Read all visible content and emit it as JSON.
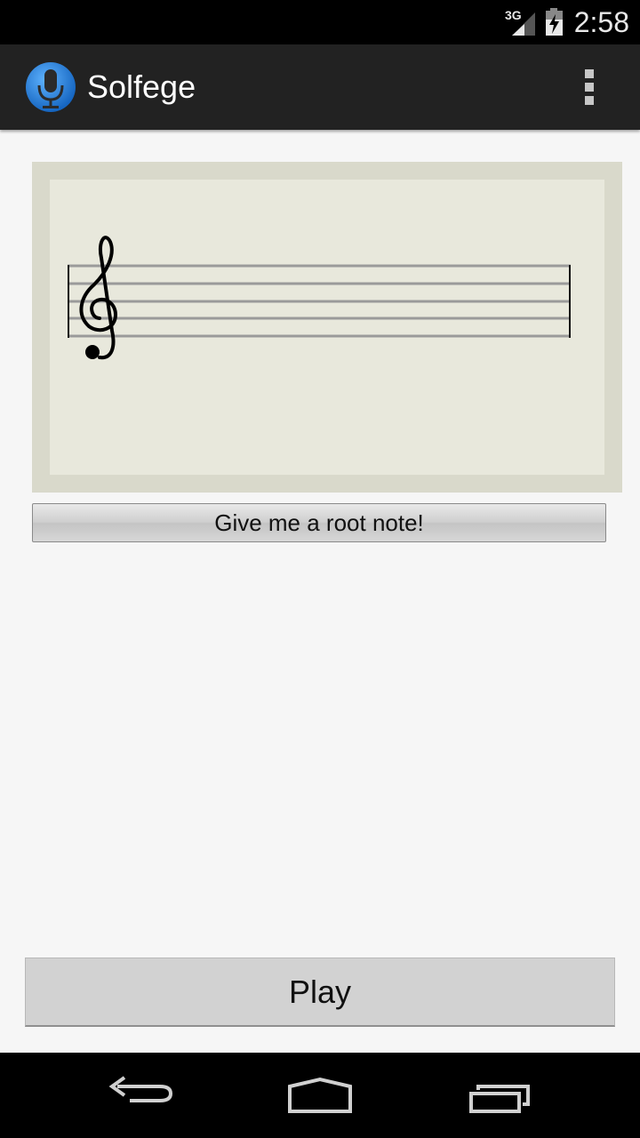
{
  "status_bar": {
    "network_label": "3G",
    "time": "2:58",
    "icons": [
      "signal-icon",
      "battery-icon"
    ]
  },
  "action_bar": {
    "title": "Solfege",
    "icons": [
      "microphone-icon",
      "overflow-menu-icon"
    ]
  },
  "staff": {
    "clef": "treble-clef-icon",
    "note_count": 0
  },
  "root_note_button": {
    "label": "Give me a root note!"
  },
  "play_button": {
    "label": "Play"
  },
  "nav_bar": {
    "icons": [
      "back-icon",
      "home-icon",
      "recent-apps-icon"
    ]
  },
  "colors": {
    "actionbar": "#222222",
    "app_icon_blue": "#1e88e5",
    "staff_outer": "#d9d9cb",
    "staff_inner": "#e8e8dc"
  }
}
